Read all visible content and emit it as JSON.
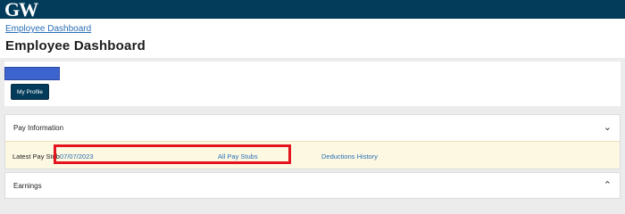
{
  "brand": {
    "logo_text": "GW",
    "bar_color": "#033c5a"
  },
  "breadcrumb": {
    "label": "Employee Dashboard"
  },
  "page": {
    "title": "Employee Dashboard"
  },
  "profile": {
    "my_profile_label": "My Profile",
    "redaction_color": "#3d63cf"
  },
  "pay_information": {
    "header": "Pay Information",
    "toggle_icon": "chevron-down-icon",
    "latest_label": "Latest Pay Stub",
    "latest_date": "07/07/2023",
    "all_stubs_label": "All Pay Stubs",
    "deductions_label": "Deductions History",
    "row_background": "#fcf8e2"
  },
  "earnings": {
    "header": "Earnings",
    "toggle_icon": "chevron-up-icon"
  },
  "highlight_color": "#e4151f"
}
